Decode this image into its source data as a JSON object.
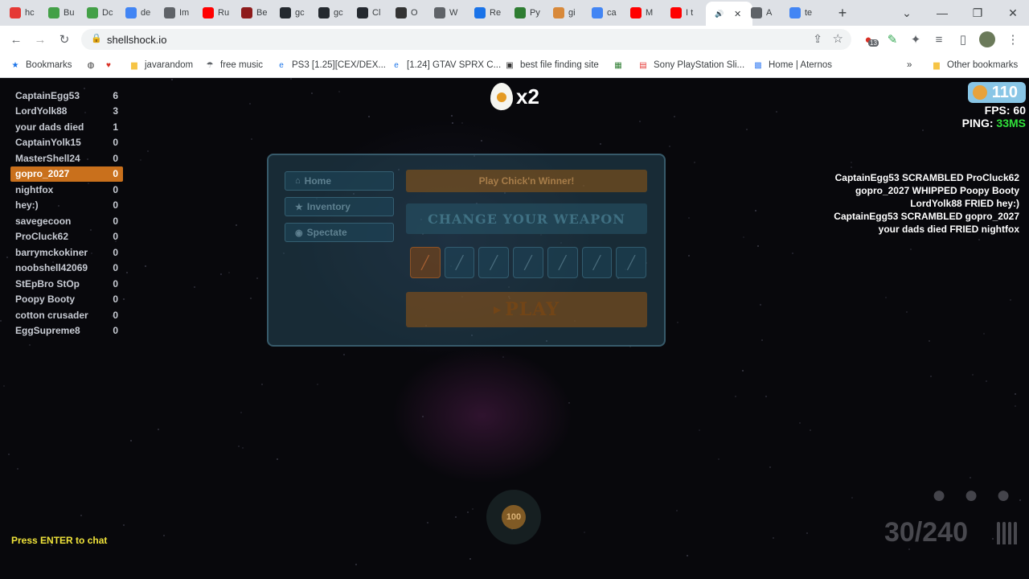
{
  "browser": {
    "tabs": [
      {
        "label": "hc",
        "color": "#e53935"
      },
      {
        "label": "Bu",
        "color": "#43a047"
      },
      {
        "label": "Dc",
        "color": "#43a047"
      },
      {
        "label": "de",
        "color": "#4285f4"
      },
      {
        "label": "Im",
        "color": "#5f6368"
      },
      {
        "label": "Ru",
        "color": "#ff0000"
      },
      {
        "label": "Be",
        "color": "#8e1b1b"
      },
      {
        "label": "gc",
        "color": "#24292f"
      },
      {
        "label": "gc",
        "color": "#24292f"
      },
      {
        "label": "Cl",
        "color": "#24292f"
      },
      {
        "label": "O",
        "color": "#333333"
      },
      {
        "label": "W",
        "color": "#5f6368"
      },
      {
        "label": "Re",
        "color": "#1a73e8"
      },
      {
        "label": "Py",
        "color": "#2e7d32"
      },
      {
        "label": "gi",
        "color": "#d8893a"
      },
      {
        "label": "ca",
        "color": "#4285f4"
      },
      {
        "label": "M",
        "color": "#ff0000"
      },
      {
        "label": "I t",
        "color": "#ff0000"
      },
      {
        "label": "",
        "color": "#333333"
      },
      {
        "label": "A",
        "color": "#5f6368"
      },
      {
        "label": "te",
        "color": "#4285f4"
      }
    ],
    "url": "shellshock.io",
    "bookmarks": [
      {
        "label": "Bookmarks",
        "icon": "star-icon"
      },
      {
        "label": "",
        "icon": "globe-icon"
      },
      {
        "label": "",
        "icon": "heart-icon"
      },
      {
        "label": "javarandom",
        "icon": "folder-icon"
      },
      {
        "label": "free music",
        "icon": "parachute-icon"
      },
      {
        "label": "PS3 [1.25][CEX/DEX...",
        "icon": "e-icon"
      },
      {
        "label": "[1.24] GTAV SPRX C...",
        "icon": "e-icon"
      },
      {
        "label": "best file finding site",
        "icon": "robot-icon"
      },
      {
        "label": "",
        "icon": "image-icon"
      },
      {
        "label": "Sony PlayStation Sli...",
        "icon": "bag-icon"
      },
      {
        "label": "Home | Aternos",
        "icon": "grid-icon"
      }
    ],
    "other_bookmarks": "Other bookmarks",
    "extension_badge": "13"
  },
  "leaderboard": [
    {
      "name": "CaptainEgg53",
      "score": "6"
    },
    {
      "name": "LordYolk88",
      "score": "3"
    },
    {
      "name": "your dads died",
      "score": "1"
    },
    {
      "name": "CaptainYolk15",
      "score": "0"
    },
    {
      "name": "MasterShell24",
      "score": "0"
    },
    {
      "name": "gopro_2027",
      "score": "0",
      "me": true
    },
    {
      "name": "nightfox",
      "score": "0"
    },
    {
      "name": "hey:)",
      "score": "0"
    },
    {
      "name": "savegecoon",
      "score": "0"
    },
    {
      "name": "ProCluck62",
      "score": "0"
    },
    {
      "name": "barrymckokiner",
      "score": "0"
    },
    {
      "name": "noobshell42069",
      "score": "0"
    },
    {
      "name": "StEpBro StOp",
      "score": "0"
    },
    {
      "name": "Poopy Booty",
      "score": "0"
    },
    {
      "name": "cotton crusader",
      "score": "0"
    },
    {
      "name": "EggSupreme8",
      "score": "0"
    }
  ],
  "hud": {
    "multiplier": "x2",
    "currency": "110",
    "fps_label": "FPS: ",
    "fps": "60",
    "ping_label": "PING: ",
    "ping": "33MS",
    "health": "100",
    "ammo": "30/240",
    "chat_hint": "Press ENTER to chat"
  },
  "killfeed": [
    "CaptainEgg53 SCRAMBLED ProCluck62",
    "gopro_2027 WHIPPED Poopy Booty",
    "LordYolk88 FRIED hey:)",
    "CaptainEgg53 SCRAMBLED gopro_2027",
    "your dads died FRIED nightfox"
  ],
  "menu": {
    "home": "Home",
    "inventory": "Inventory",
    "spectate": "Spectate",
    "chick_button": "Play Chick'n Winner!",
    "weapon_title": "CHANGE YOUR WEAPON",
    "play": "PLAY"
  },
  "colors": {
    "player_highlight": "#c9701c",
    "ping": "#30e03a",
    "chat_hint": "#f0e33a"
  }
}
